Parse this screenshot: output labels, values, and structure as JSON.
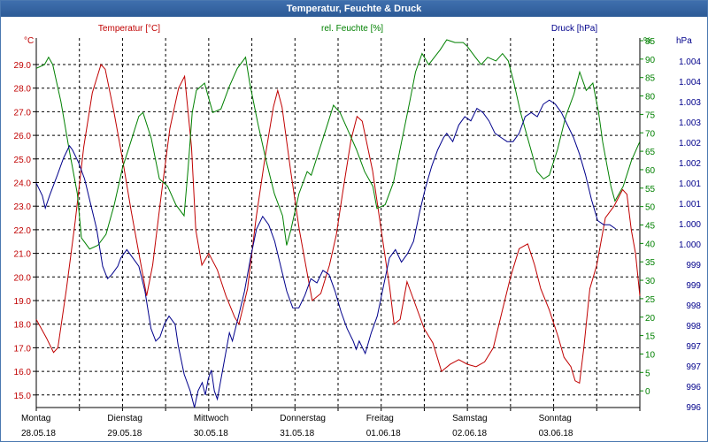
{
  "window": {
    "title": "Temperatur, Feuchte & Druck"
  },
  "colors": {
    "temperature": "#c00000",
    "humidity": "#008000",
    "pressure": "#00008b",
    "grid": "#000000",
    "title_bar": "#2f5f9e"
  },
  "chart_data": {
    "type": "line",
    "title": "Temperatur, Feuchte & Druck",
    "grid": true,
    "axes": {
      "temperature": {
        "label": "Temperatur [°C]",
        "unit": "°C",
        "side": "left",
        "range": [
          15.0,
          29.0
        ],
        "ticks": [
          "29.0",
          "28.0",
          "27.0",
          "26.0",
          "25.0",
          "24.0",
          "23.0",
          "22.0",
          "21.0",
          "20.0",
          "19.0",
          "18.0",
          "17.0",
          "16.0",
          "15.0"
        ]
      },
      "humidity": {
        "label": "rel. Feuchte [%]",
        "unit": "%",
        "side": "right",
        "range": [
          0,
          95
        ],
        "ticks": [
          "95",
          "90",
          "85",
          "80",
          "75",
          "70",
          "65",
          "60",
          "55",
          "50",
          "45",
          "40",
          "35",
          "30",
          "25",
          "20",
          "15",
          "10",
          "5",
          "0"
        ]
      },
      "pressure": {
        "label": "Druck [hPa]",
        "unit": "hPa",
        "side": "right",
        "range": [
          996,
          1004
        ],
        "ticks": [
          "1.004",
          "1.004",
          "1.003",
          "1.003",
          "1.002",
          "1.002",
          "1.001",
          "1.001",
          "1.000",
          "1.000",
          "999",
          "999",
          "998",
          "998",
          "997",
          "997",
          "996",
          "996"
        ]
      }
    },
    "x_categories": [
      {
        "day": "Montag",
        "date": "28.05.18"
      },
      {
        "day": "Dienstag",
        "date": "29.05.18"
      },
      {
        "day": "Mittwoch",
        "date": "30.05.18"
      },
      {
        "day": "Donnerstag",
        "date": "31.05.18"
      },
      {
        "day": "Freitag",
        "date": "01.06.18"
      },
      {
        "day": "Samstag",
        "date": "02.06.18"
      },
      {
        "day": "Sonntag",
        "date": "03.06.18"
      }
    ],
    "x_range_days": [
      0,
      7.0
    ],
    "series": [
      {
        "name": "Temperatur [°C]",
        "axis": "temperature",
        "points": [
          [
            0,
            18.2
          ],
          [
            0.12,
            17.4
          ],
          [
            0.2,
            16.8
          ],
          [
            0.25,
            17.0
          ],
          [
            0.35,
            19.5
          ],
          [
            0.45,
            22.3
          ],
          [
            0.55,
            25.5
          ],
          [
            0.65,
            27.8
          ],
          [
            0.75,
            29.0
          ],
          [
            0.8,
            28.8
          ],
          [
            0.9,
            27.0
          ],
          [
            1.0,
            25.0
          ],
          [
            1.1,
            22.8
          ],
          [
            1.2,
            20.8
          ],
          [
            1.28,
            19.2
          ],
          [
            1.35,
            20.5
          ],
          [
            1.45,
            23.5
          ],
          [
            1.55,
            26.3
          ],
          [
            1.65,
            28.0
          ],
          [
            1.72,
            28.5
          ],
          [
            1.8,
            25.5
          ],
          [
            1.85,
            22.0
          ],
          [
            1.92,
            20.5
          ],
          [
            2.0,
            21.0
          ],
          [
            2.1,
            20.3
          ],
          [
            2.2,
            19.2
          ],
          [
            2.3,
            18.3
          ],
          [
            2.35,
            18.0
          ],
          [
            2.45,
            19.5
          ],
          [
            2.55,
            22.5
          ],
          [
            2.65,
            25.0
          ],
          [
            2.75,
            27.2
          ],
          [
            2.8,
            27.9
          ],
          [
            2.85,
            27.2
          ],
          [
            2.95,
            24.5
          ],
          [
            3.05,
            22.0
          ],
          [
            3.15,
            20.0
          ],
          [
            3.2,
            19.0
          ],
          [
            3.3,
            19.3
          ],
          [
            3.4,
            20.5
          ],
          [
            3.48,
            21.8
          ],
          [
            3.55,
            23.5
          ],
          [
            3.65,
            25.8
          ],
          [
            3.72,
            26.8
          ],
          [
            3.78,
            26.6
          ],
          [
            3.9,
            24.5
          ],
          [
            4.0,
            22.0
          ],
          [
            4.1,
            19.5
          ],
          [
            4.15,
            18.0
          ],
          [
            4.22,
            18.2
          ],
          [
            4.3,
            19.8
          ],
          [
            4.38,
            19.0
          ],
          [
            4.5,
            17.8
          ],
          [
            4.6,
            17.2
          ],
          [
            4.7,
            16.0
          ],
          [
            4.8,
            16.3
          ],
          [
            4.9,
            16.5
          ],
          [
            5.0,
            16.3
          ],
          [
            5.1,
            16.2
          ],
          [
            5.2,
            16.4
          ],
          [
            5.3,
            17.0
          ],
          [
            5.4,
            18.5
          ],
          [
            5.5,
            20.0
          ],
          [
            5.6,
            21.2
          ],
          [
            5.7,
            21.4
          ],
          [
            5.78,
            20.5
          ],
          [
            5.85,
            19.5
          ],
          [
            5.95,
            18.6
          ],
          [
            6.05,
            17.5
          ],
          [
            6.12,
            16.6
          ],
          [
            6.2,
            16.2
          ],
          [
            6.25,
            15.6
          ],
          [
            6.3,
            15.5
          ],
          [
            6.35,
            17.0
          ],
          [
            6.42,
            19.5
          ],
          [
            6.5,
            20.5
          ],
          [
            6.6,
            22.5
          ],
          [
            6.7,
            23.0
          ],
          [
            6.8,
            23.7
          ],
          [
            6.85,
            23.5
          ],
          [
            6.9,
            22.0
          ],
          [
            6.95,
            21.0
          ],
          [
            7.0,
            19.2
          ]
        ]
      },
      {
        "name": "rel. Feuchte [%]",
        "axis": "humidity",
        "points": [
          [
            0,
            92
          ],
          [
            0.1,
            93
          ],
          [
            0.15,
            95
          ],
          [
            0.2,
            93
          ],
          [
            0.3,
            83
          ],
          [
            0.4,
            70
          ],
          [
            0.5,
            58
          ],
          [
            0.55,
            46
          ],
          [
            0.65,
            43
          ],
          [
            0.75,
            44
          ],
          [
            0.85,
            47
          ],
          [
            0.95,
            55
          ],
          [
            1.05,
            65
          ],
          [
            1.15,
            72
          ],
          [
            1.25,
            79
          ],
          [
            1.3,
            80
          ],
          [
            1.4,
            73
          ],
          [
            1.5,
            62
          ],
          [
            1.6,
            60
          ],
          [
            1.7,
            55
          ],
          [
            1.8,
            52
          ],
          [
            1.85,
            65
          ],
          [
            1.9,
            80
          ],
          [
            1.95,
            86
          ],
          [
            2.05,
            88
          ],
          [
            2.15,
            80
          ],
          [
            2.25,
            81
          ],
          [
            2.35,
            87
          ],
          [
            2.45,
            92
          ],
          [
            2.55,
            95
          ],
          [
            2.6,
            88
          ],
          [
            2.7,
            77
          ],
          [
            2.8,
            67
          ],
          [
            2.9,
            58
          ],
          [
            3.0,
            52
          ],
          [
            3.05,
            44
          ],
          [
            3.1,
            48
          ],
          [
            3.2,
            58
          ],
          [
            3.3,
            64
          ],
          [
            3.35,
            63
          ],
          [
            3.45,
            70
          ],
          [
            3.55,
            77
          ],
          [
            3.62,
            82
          ],
          [
            3.7,
            80
          ],
          [
            3.8,
            75
          ],
          [
            3.9,
            70
          ],
          [
            4.0,
            64
          ],
          [
            4.1,
            60
          ],
          [
            4.15,
            54
          ],
          [
            4.25,
            55
          ],
          [
            4.35,
            61
          ],
          [
            4.45,
            72
          ],
          [
            4.55,
            83
          ],
          [
            4.62,
            91
          ],
          [
            4.7,
            96
          ],
          [
            4.78,
            93
          ],
          [
            4.85,
            95
          ],
          [
            4.92,
            97
          ],
          [
            5.0,
            100
          ],
          [
            5.1,
            99
          ],
          [
            5.2,
            99
          ],
          [
            5.25,
            98
          ],
          [
            5.35,
            95
          ],
          [
            5.42,
            93
          ],
          [
            5.5,
            95
          ],
          [
            5.6,
            94
          ],
          [
            5.68,
            96
          ],
          [
            5.75,
            94
          ],
          [
            5.82,
            88
          ],
          [
            5.9,
            80
          ],
          [
            6.0,
            72
          ],
          [
            6.1,
            64
          ],
          [
            6.18,
            62
          ],
          [
            6.25,
            63
          ],
          [
            6.35,
            70
          ],
          [
            6.45,
            79
          ],
          [
            6.55,
            85
          ],
          [
            6.62,
            91
          ],
          [
            6.7,
            86
          ],
          [
            6.78,
            88
          ],
          [
            6.85,
            80
          ],
          [
            6.9,
            72
          ],
          [
            6.95,
            66
          ],
          [
            7.0,
            60
          ],
          [
            7.05,
            56
          ],
          [
            7.15,
            60
          ],
          [
            7.25,
            67
          ],
          [
            7.35,
            72
          ]
        ]
      },
      {
        "name": "Druck [hPa]",
        "axis": "pressure",
        "points": [
          [
            0,
            1001.4
          ],
          [
            0.1,
            1001.1
          ],
          [
            0.15,
            1000.8
          ],
          [
            0.22,
            1001.1
          ],
          [
            0.35,
            1001.6
          ],
          [
            0.45,
            1002.0
          ],
          [
            0.55,
            1002.3
          ],
          [
            0.6,
            1002.2
          ],
          [
            0.7,
            1001.9
          ],
          [
            0.8,
            1001.5
          ],
          [
            0.9,
            1000.9
          ],
          [
            1.0,
            1000.3
          ],
          [
            1.1,
            999.4
          ],
          [
            1.18,
            999.1
          ],
          [
            1.25,
            999.2
          ],
          [
            1.35,
            999.4
          ],
          [
            1.4,
            999.6
          ],
          [
            1.5,
            999.8
          ],
          [
            1.6,
            999.6
          ],
          [
            1.7,
            999.4
          ],
          [
            1.8,
            998.8
          ],
          [
            1.9,
            997.9
          ],
          [
            1.98,
            997.6
          ],
          [
            2.05,
            997.7
          ],
          [
            2.12,
            998.0
          ],
          [
            2.2,
            998.2
          ],
          [
            2.3,
            998.0
          ],
          [
            2.35,
            997.5
          ],
          [
            2.45,
            996.8
          ],
          [
            2.55,
            996.4
          ],
          [
            2.62,
            996.0
          ],
          [
            2.68,
            996.4
          ],
          [
            2.75,
            996.6
          ],
          [
            2.8,
            996.3
          ],
          [
            2.85,
            996.7
          ],
          [
            2.9,
            996.9
          ],
          [
            2.95,
            996.4
          ],
          [
            3.0,
            996.2
          ],
          [
            3.05,
            996.6
          ],
          [
            3.1,
            997.0
          ],
          [
            3.15,
            997.4
          ],
          [
            3.2,
            997.8
          ],
          [
            3.25,
            997.6
          ],
          [
            3.35,
            998.2
          ],
          [
            3.45,
            998.8
          ],
          [
            3.55,
            999.6
          ],
          [
            3.65,
            1000.3
          ],
          [
            3.75,
            1000.6
          ],
          [
            3.85,
            1000.4
          ],
          [
            3.95,
            1000.0
          ],
          [
            4.05,
            999.4
          ],
          [
            4.15,
            998.8
          ],
          [
            4.25,
            998.4
          ],
          [
            4.35,
            998.4
          ],
          [
            4.45,
            998.7
          ],
          [
            4.55,
            999.1
          ],
          [
            4.65,
            999.0
          ],
          [
            4.75,
            999.3
          ],
          [
            4.85,
            999.2
          ],
          [
            4.95,
            998.8
          ],
          [
            5.05,
            998.3
          ],
          [
            5.15,
            997.9
          ],
          [
            5.25,
            997.6
          ],
          [
            5.3,
            997.4
          ],
          [
            5.35,
            997.6
          ],
          [
            5.45,
            997.3
          ],
          [
            5.55,
            997.8
          ],
          [
            5.65,
            998.2
          ],
          [
            5.75,
            998.9
          ],
          [
            5.85,
            999.6
          ],
          [
            5.95,
            999.8
          ],
          [
            6.05,
            999.5
          ],
          [
            6.15,
            999.7
          ],
          [
            6.25,
            1000.0
          ],
          [
            6.35,
            1000.7
          ],
          [
            6.45,
            1001.3
          ],
          [
            6.55,
            1001.8
          ],
          [
            6.65,
            1002.2
          ],
          [
            6.75,
            1002.5
          ],
          [
            6.8,
            1002.6
          ],
          [
            6.9,
            1002.4
          ],
          [
            7.0,
            1002.8
          ],
          [
            7.1,
            1003.0
          ],
          [
            7.2,
            1002.9
          ],
          [
            7.3,
            1003.2
          ],
          [
            7.4,
            1003.1
          ],
          [
            7.5,
            1002.9
          ],
          [
            7.6,
            1002.6
          ],
          [
            7.7,
            1002.5
          ],
          [
            7.8,
            1002.4
          ],
          [
            7.9,
            1002.4
          ],
          [
            8.0,
            1002.6
          ],
          [
            8.1,
            1003.0
          ],
          [
            8.2,
            1003.1
          ],
          [
            8.3,
            1003.0
          ],
          [
            8.4,
            1003.3
          ],
          [
            8.5,
            1003.4
          ],
          [
            8.6,
            1003.3
          ],
          [
            8.7,
            1003.1
          ],
          [
            8.8,
            1002.8
          ],
          [
            8.9,
            1002.5
          ],
          [
            9.0,
            1002.1
          ],
          [
            9.1,
            1001.6
          ],
          [
            9.2,
            1001.0
          ],
          [
            9.3,
            1000.5
          ],
          [
            9.4,
            1000.4
          ],
          [
            9.5,
            1000.4
          ],
          [
            9.6,
            1000.3
          ]
        ]
      }
    ]
  }
}
